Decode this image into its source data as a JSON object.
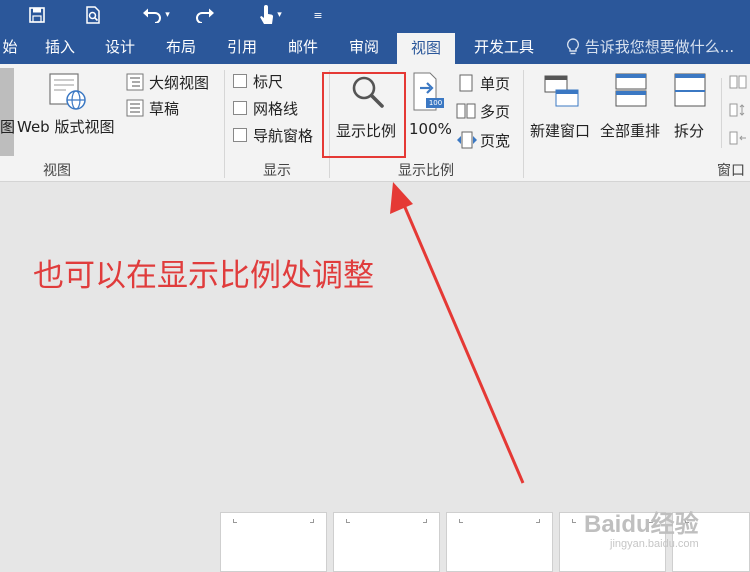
{
  "tabs": [
    {
      "label": "始"
    },
    {
      "label": "插入"
    },
    {
      "label": "设计"
    },
    {
      "label": "布局"
    },
    {
      "label": "引用"
    },
    {
      "label": "邮件"
    },
    {
      "label": "审阅"
    },
    {
      "label": "视图"
    },
    {
      "label": "开发工具"
    }
  ],
  "active_tab": "视图",
  "tell_me": "告诉我您想要做什么...",
  "ribbon": {
    "views": {
      "partial_label": "图",
      "web_layout": "Web 版式视图",
      "outline": "大纲视图",
      "draft": "草稿",
      "group_label": "视图"
    },
    "show": {
      "ruler": "标尺",
      "gridlines": "网格线",
      "nav_pane": "导航窗格",
      "group_label": "显示"
    },
    "zoom": {
      "zoom_btn": "显示比例",
      "hundred": "100%",
      "hundred_badge": "100",
      "one_page": "单页",
      "multi_page": "多页",
      "page_width": "页宽",
      "group_label": "显示比例"
    },
    "window": {
      "new_window": "新建窗口",
      "arrange_all": "全部重排",
      "split": "拆分",
      "group_label": "窗口"
    }
  },
  "annotation": "也可以在显示比例处调整",
  "watermark": {
    "brand": "Baidu经验",
    "url": "jingyan.baidu.com"
  },
  "colors": {
    "ribbon_blue": "#2b579a",
    "annotation_red": "#e03c3c"
  }
}
